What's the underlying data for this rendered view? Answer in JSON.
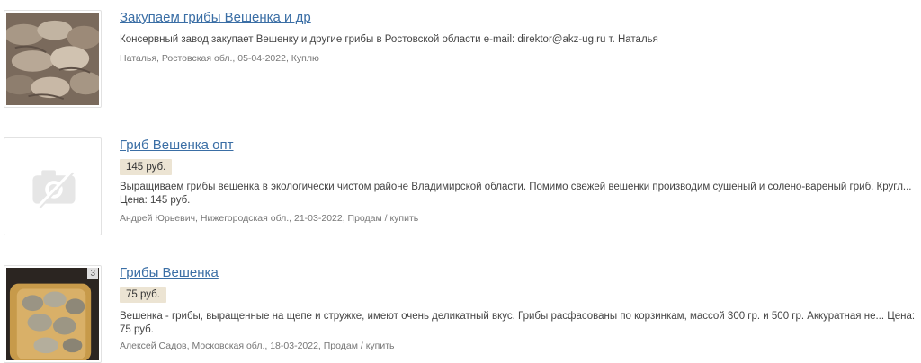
{
  "listings": [
    {
      "title": "Закупаем грибы Вешенка и др",
      "description": "Консервный завод закупает Вешенку и другие грибы в Ростовской области e-mail: direktor@akz-ug.ru т. Наталья",
      "meta": "Наталья, Ростовская обл., 05-04-2022, Куплю",
      "image": "oyster-mushroom-photo"
    },
    {
      "title": "Гриб Вешенка опт",
      "price": "145 руб.",
      "description": "Выращиваем грибы вешенка в экологически чистом районе Владимирской области. Помимо свежей вешенки производим сушеный и солено-вареный гриб. Кругл... Цена: 145 руб.",
      "meta": "Андрей Юрьевич, Нижегородская обл., 21-03-2022, Продам / купить",
      "image": "no-photo-camera-icon"
    },
    {
      "title": "Грибы Вешенка",
      "price": "75 руб.",
      "description": "Вешенка - грибы, выращенные на щепе и стружке, имеют очень деликатный вкус. Грибы расфасованы по корзинкам, массой 300 гр. и 500 гр. Аккуратная не... Цена: 75 руб.",
      "meta": "Алексей Садов, Московская обл., 18-03-2022, Продам / купить",
      "image": "mushroom-basket-photo",
      "photo_count": "3"
    }
  ]
}
